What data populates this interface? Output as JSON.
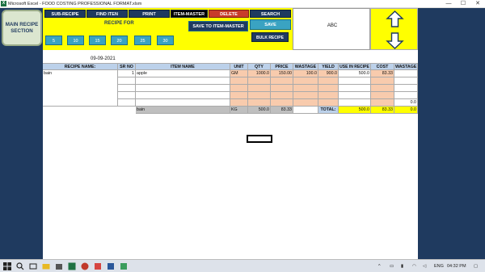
{
  "window": {
    "app_icon": "X",
    "title": "Microsoft Excel - FOOD COSTING PROFESSIONAL FORMAT.xlsm",
    "min": "—",
    "max": "☐",
    "close": "✕"
  },
  "sidebar": {
    "main_button": "MAIN RECIPE SECTION"
  },
  "toolbar": {
    "sub_recipe": "SUB-RECIPE",
    "find_item": "FIND ITEN",
    "print": "PRINT",
    "item_master": "ITEM-MASTER",
    "delete": "DELETE",
    "search": "SEARCH",
    "recipe_for_label": "RECIPE FOR",
    "save_to_item_master": "SAVE TO ITEM-MASTER",
    "save": "SAVE",
    "bulk_recipe": "BULK RECIPE",
    "recipe_for_options": [
      "5",
      "10",
      "15",
      "20",
      "25",
      "30"
    ]
  },
  "info_box": {
    "text": "ABC"
  },
  "arrows": {
    "up_icon": "arrow-up-icon",
    "down_icon": "arrow-down-icon"
  },
  "sheet": {
    "date": "09-09-2021",
    "headers": [
      "RECIPE NAME:",
      "SR NO",
      "ITEM NAME",
      "UNIT",
      "QTY",
      "PRICE",
      "WASTAGE",
      "YIELD",
      "USE IN RECIPE",
      "COST",
      "WASTAGE"
    ],
    "row1": {
      "recipe_name": "bain",
      "sr_no": "1",
      "item_name": "apple",
      "unit": "GM",
      "qty": "1000.0",
      "price": "150.00",
      "wastage": "100.0",
      "yield": "900.0",
      "use_in_recipe": "500.0",
      "cost": "83.33",
      "wastage_total": ""
    },
    "row5_wastage": "0.0",
    "total_row": {
      "name": "bain",
      "unit": "KG",
      "qty": "500.0",
      "cost": "83.33",
      "label": "TOTAL:",
      "use_total": "500.0",
      "cost_total": "83.33",
      "wastage_total": "0.0"
    }
  },
  "taskbar": {
    "lang": "ENG",
    "time": "04:32 PM",
    "colors": {
      "accent": "#1f3a5f",
      "panel": "#ffff00",
      "header": "#bcd1ea",
      "input": "#f8cbad"
    }
  }
}
